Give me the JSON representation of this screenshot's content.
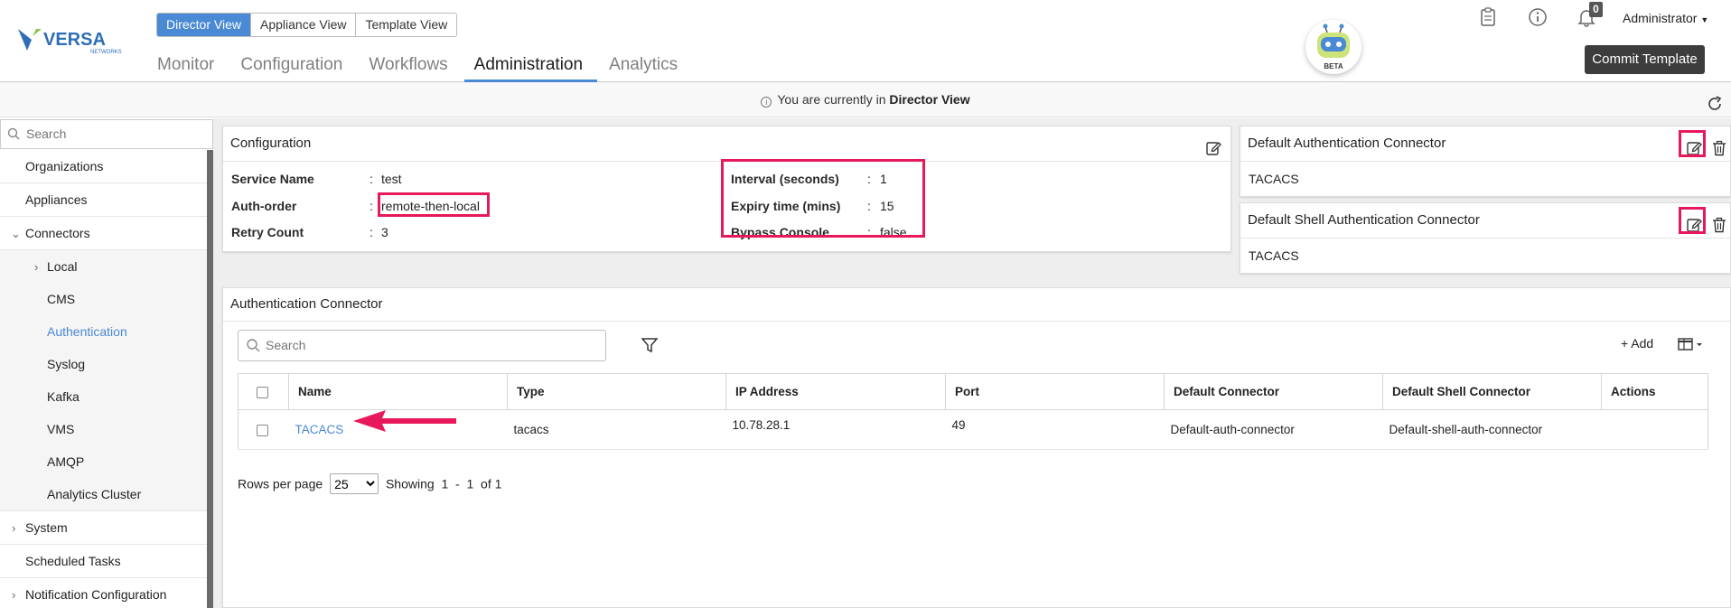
{
  "brand": {
    "name": "VERSA",
    "sub": "NETWORKS"
  },
  "view_switch": [
    "Director View",
    "Appliance View",
    "Template View"
  ],
  "nav_tabs": [
    "Monitor",
    "Configuration",
    "Workflows",
    "Administration",
    "Analytics"
  ],
  "bot_label": "BETA",
  "notifications_count": "0",
  "user_menu": "Administrator",
  "commit_button": "Commit Template",
  "infobar": {
    "prefix": "You are currently in",
    "view": "Director View"
  },
  "sidebar": {
    "search_placeholder": "Search",
    "items": [
      "Organizations",
      "Appliances",
      "Connectors",
      "Local",
      "CMS",
      "Authentication",
      "Syslog",
      "Kafka",
      "VMS",
      "AMQP",
      "Analytics Cluster",
      "System",
      "Scheduled Tasks",
      "Notification Configuration"
    ]
  },
  "config": {
    "title": "Configuration",
    "left": [
      {
        "label": "Service Name",
        "value": "test"
      },
      {
        "label": "Auth-order",
        "value": "remote-then-local"
      },
      {
        "label": "Retry Count",
        "value": "3"
      }
    ],
    "right": [
      {
        "label": "Interval (seconds)",
        "value": "1"
      },
      {
        "label": "Expiry time (mins)",
        "value": "15"
      },
      {
        "label": "Bypass Console",
        "value": "false"
      }
    ]
  },
  "default_auth": {
    "title": "Default Authentication Connector",
    "value": "TACACS"
  },
  "default_shell": {
    "title": "Default Shell Authentication Connector",
    "value": "TACACS"
  },
  "auth_connector": {
    "title": "Authentication Connector",
    "search_placeholder": "Search",
    "add_label": "+ Add",
    "columns": [
      "Name",
      "Type",
      "IP Address",
      "Port",
      "Default Connector",
      "Default Shell Connector",
      "Actions"
    ],
    "rows": [
      {
        "name": "TACACS",
        "type": "tacacs",
        "ip": "10.78.28.1",
        "port": "49",
        "default_connector": "Default-auth-connector",
        "default_shell": "Default-shell-auth-connector",
        "actions": ""
      }
    ],
    "pager": {
      "rows_label": "Rows per page",
      "rows_value": "25",
      "showing_label": "Showing",
      "from": "1",
      "sep": "-",
      "to": "1",
      "of": "of 1"
    }
  },
  "colors": {
    "accent": "#4a89d4",
    "highlight": "#e8195a",
    "commit_bg": "#3d3d3d"
  }
}
